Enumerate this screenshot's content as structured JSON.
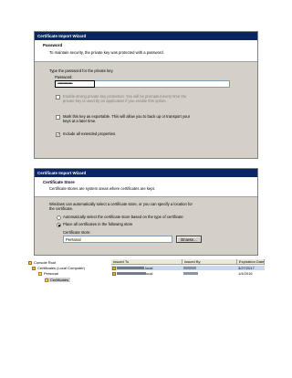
{
  "dialog1": {
    "title": "Certificate Import Wizard",
    "header_title": "Password",
    "header_subtitle": "To maintain security, the private key was protected with a password.",
    "prompt": "Type the password for the private key.",
    "password_label": "Password:",
    "password_value": "•••••••••••••",
    "opt_strong_line1": "Enable strong private key protection. You will be prompted every time the",
    "opt_strong_line2": "private key is used by an application if you enable this option.",
    "opt_strong_checked": false,
    "opt_export_line1": "Mark this key as exportable. This will allow you to back up or transport your",
    "opt_export_line2": "keys at a later time.",
    "opt_export_checked": false,
    "opt_extended": "Include all extended properties.",
    "opt_extended_checked": true
  },
  "dialog2": {
    "title": "Certificate Import Wizard",
    "header_title": "Certificate Store",
    "header_subtitle": "Certificate stores are system areas where certificates are kept.",
    "desc_line1": "Windows can automatically select a certificate store, or you can specify a location for",
    "desc_line2": "the certificate.",
    "radio_auto": "Automatically select the certificate store based on the type of certificate",
    "radio_auto_selected": false,
    "radio_place": "Place all certificates in the following store",
    "radio_place_selected": true,
    "store_label": "Certificate store:",
    "store_value": "Personal",
    "browse_label": "Browse..."
  },
  "console": {
    "tree": [
      {
        "label": "Console Root",
        "icon": "folder-icon"
      },
      {
        "label": "Certificates (Local Computer)",
        "icon": "certificate-snapin-icon"
      },
      {
        "label": "Personal",
        "icon": "folder-icon"
      },
      {
        "label": "Certificates",
        "icon": "folder-icon",
        "selected": true
      }
    ],
    "columns": {
      "issued_to": "Issued To",
      "issued_by": "Issued By",
      "expiration": "Expiration Date"
    },
    "rows": [
      {
        "issued_to_suffix": ".local",
        "expiration": "3/27/2017",
        "selected": true
      },
      {
        "issued_to_suffix": "ocal",
        "expiration": "1/4/2016",
        "selected": false
      }
    ]
  }
}
